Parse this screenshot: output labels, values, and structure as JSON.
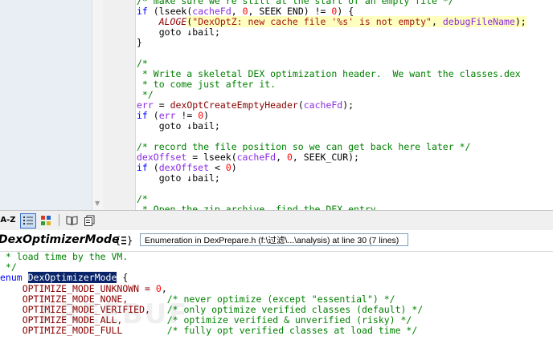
{
  "top_code": {
    "lines": [
      [
        {
          "t": "/* make sure we're still at the start of an empty file */",
          "c": "c-cm"
        }
      ],
      [
        {
          "t": "if ",
          "c": "c-kw"
        },
        {
          "t": "(",
          "c": "c-plain"
        },
        {
          "t": "lseek",
          "c": "c-plain"
        },
        {
          "t": "(",
          "c": "c-plain"
        },
        {
          "t": "cacheFd",
          "c": "c-var"
        },
        {
          "t": ", ",
          "c": "c-plain"
        },
        {
          "t": "0",
          "c": "c-num"
        },
        {
          "t": ", SEEK_END) != ",
          "c": "c-plain"
        },
        {
          "t": "0",
          "c": "c-num"
        },
        {
          "t": ") {",
          "c": "c-plain"
        }
      ],
      [
        {
          "t": "    ",
          "c": "c-plain"
        },
        {
          "t": "ALOGE",
          "c": "c-mac"
        },
        {
          "t": "(",
          "c": "c-hl c-plain"
        },
        {
          "t": "\"DexOptZ: new cache file '%s' is not empty\"",
          "c": "c-hl c-str"
        },
        {
          "t": ", ",
          "c": "c-hl c-plain"
        },
        {
          "t": "debugFileName",
          "c": "c-hl c-var"
        },
        {
          "t": ");",
          "c": "c-hl c-plain"
        }
      ],
      [
        {
          "t": "    ",
          "c": "c-plain"
        },
        {
          "t": "goto ",
          "c": "c-plain"
        },
        {
          "t": "↓bail;",
          "c": "c-plain"
        }
      ],
      [
        {
          "t": "}",
          "c": "c-plain"
        }
      ],
      [
        {
          "t": "",
          "c": "c-plain"
        }
      ],
      [
        {
          "t": "/*",
          "c": "c-cm"
        }
      ],
      [
        {
          "t": " * Write a skeletal DEX optimization header.  We want the classes.dex",
          "c": "c-cm"
        }
      ],
      [
        {
          "t": " * to come just after it.",
          "c": "c-cm"
        }
      ],
      [
        {
          "t": " */",
          "c": "c-cm"
        }
      ],
      [
        {
          "t": "err",
          "c": "c-var"
        },
        {
          "t": " = ",
          "c": "c-plain"
        },
        {
          "t": "dexOptCreateEmptyHeader",
          "c": "c-fn"
        },
        {
          "t": "(",
          "c": "c-plain"
        },
        {
          "t": "cacheFd",
          "c": "c-var"
        },
        {
          "t": ");",
          "c": "c-plain"
        }
      ],
      [
        {
          "t": "if ",
          "c": "c-kw"
        },
        {
          "t": "(",
          "c": "c-plain"
        },
        {
          "t": "err",
          "c": "c-var"
        },
        {
          "t": " != ",
          "c": "c-plain"
        },
        {
          "t": "0",
          "c": "c-num"
        },
        {
          "t": ")",
          "c": "c-plain"
        }
      ],
      [
        {
          "t": "    goto ↓bail;",
          "c": "c-plain"
        }
      ],
      [
        {
          "t": "",
          "c": "c-plain"
        }
      ],
      [
        {
          "t": "/* record the file position so we can get back here later */",
          "c": "c-cm"
        }
      ],
      [
        {
          "t": "dexOffset",
          "c": "c-var"
        },
        {
          "t": " = lseek(",
          "c": "c-plain"
        },
        {
          "t": "cacheFd",
          "c": "c-var"
        },
        {
          "t": ", ",
          "c": "c-plain"
        },
        {
          "t": "0",
          "c": "c-num"
        },
        {
          "t": ", SEEK_CUR);",
          "c": "c-plain"
        }
      ],
      [
        {
          "t": "if ",
          "c": "c-kw"
        },
        {
          "t": "(",
          "c": "c-plain"
        },
        {
          "t": "dexOffset",
          "c": "c-var"
        },
        {
          "t": " < ",
          "c": "c-plain"
        },
        {
          "t": "0",
          "c": "c-num"
        },
        {
          "t": ")",
          "c": "c-plain"
        }
      ],
      [
        {
          "t": "    goto ↓bail;",
          "c": "c-plain"
        }
      ],
      [
        {
          "t": "",
          "c": "c-plain"
        }
      ],
      [
        {
          "t": "/*",
          "c": "c-cm"
        }
      ],
      [
        {
          "t": " * Open the zip archive, find the DEX entry.",
          "c": "c-cm"
        }
      ]
    ]
  },
  "toolbar": {
    "sort_label": "A-Z"
  },
  "symbol": {
    "name": "DexOptimizerMode",
    "info": "Enumeration in DexPrepare.h (f:\\过滤\\...\\analysis) at line 30 (7 lines)"
  },
  "bottom_code": {
    "lines": [
      [
        {
          "t": " * load time by the VM.",
          "c": "c-cm"
        }
      ],
      [
        {
          "t": " */",
          "c": "c-cm"
        }
      ],
      [
        {
          "t": "enum ",
          "c": "c-kw"
        },
        {
          "t": "DexOptimizerMode",
          "c": "c-sel"
        },
        {
          "t": " {",
          "c": "c-plain"
        }
      ],
      [
        {
          "t": "    OPTIMIZE_MODE_UNKNOWN = ",
          "c": "c-fn"
        },
        {
          "t": "0",
          "c": "c-num"
        },
        {
          "t": ",",
          "c": "c-plain"
        }
      ],
      [
        {
          "t": "    OPTIMIZE_MODE_NONE,       ",
          "c": "c-fn"
        },
        {
          "t": "/* never optimize (except \"essential\") */",
          "c": "c-cm"
        }
      ],
      [
        {
          "t": "    OPTIMIZE_MODE_VERIFIED,   ",
          "c": "c-fn"
        },
        {
          "t": "/* only optimize verified classes (default) */",
          "c": "c-cm"
        }
      ],
      [
        {
          "t": "    OPTIMIZE_MODE_ALL,        ",
          "c": "c-fn"
        },
        {
          "t": "/* optimize verified & unverified (risky) */",
          "c": "c-cm"
        }
      ],
      [
        {
          "t": "    OPTIMIZE_MODE_FULL        ",
          "c": "c-fn"
        },
        {
          "t": "/* fully opt verified classes at load time */",
          "c": "c-cm"
        }
      ]
    ]
  },
  "watermark": "FREEBUF",
  "icons": {
    "categorized": "categorized-list-icon",
    "props": "properties-icon",
    "book": "book-icon",
    "pages": "pages-icon",
    "enum": "enum-icon"
  }
}
